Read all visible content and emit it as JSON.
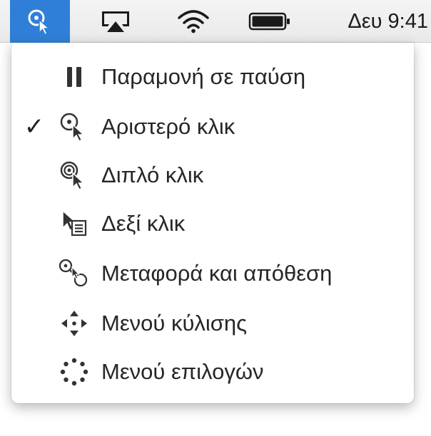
{
  "menubar": {
    "status_items": [
      {
        "name": "dwell-control-icon",
        "active": true
      },
      {
        "name": "airplay-icon"
      },
      {
        "name": "wifi-icon"
      },
      {
        "name": "battery-icon"
      }
    ],
    "clock": "Δευ 9:41",
    "accent_color": "#2f7fd8"
  },
  "menu": {
    "items": [
      {
        "label": "Παραμονή σε παύση",
        "icon": "pause-icon",
        "checked": false
      },
      {
        "label": "Αριστερό κλικ",
        "icon": "left-click-icon",
        "checked": true
      },
      {
        "label": "Διπλό κλικ",
        "icon": "double-click-icon",
        "checked": false
      },
      {
        "label": "Δεξί κλικ",
        "icon": "right-click-icon",
        "checked": false
      },
      {
        "label": "Μεταφορά και απόθεση",
        "icon": "drag-and-drop-icon",
        "checked": false
      },
      {
        "label": "Μενού κύλισης",
        "icon": "scroll-menu-icon",
        "checked": false
      },
      {
        "label": "Μενού επιλογών",
        "icon": "options-menu-icon",
        "checked": false
      }
    ],
    "check_mark": "✓"
  }
}
